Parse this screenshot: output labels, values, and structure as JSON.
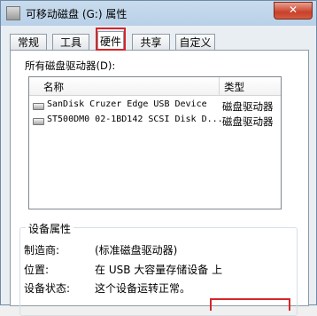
{
  "window": {
    "title": "可移动磁盘 (G:) 属性",
    "close_label": "✕"
  },
  "tabs": [
    {
      "label": "常规"
    },
    {
      "label": "工具"
    },
    {
      "label": "硬件"
    },
    {
      "label": "共享"
    },
    {
      "label": "自定义"
    }
  ],
  "active_tab": "硬件",
  "panel": {
    "drives_label": "所有磁盘驱动器(D):",
    "columns": {
      "name": "名称",
      "type": "类型"
    },
    "rows": [
      {
        "name": "SanDisk Cruzer Edge USB Device",
        "type": "磁盘驱动器"
      },
      {
        "name": "ST500DM0 02-1BD142 SCSI Disk D...",
        "type": "磁盘驱动器"
      }
    ],
    "properties": {
      "title": "设备属性",
      "manufacturer_label": "制造商:",
      "manufacturer_value": "(标准磁盘驱动器)",
      "location_label": "位置:",
      "location_value": "在 USB 大容量存储设备 上",
      "status_label": "设备状态:",
      "status_value": "这个设备运转正常。"
    }
  },
  "colors": {
    "highlight": "#d5262a",
    "title_bar": "#b8d0e8"
  },
  "icons": {
    "title": "drive-icon",
    "row": "disk-drive-icon",
    "close": "close-icon"
  }
}
